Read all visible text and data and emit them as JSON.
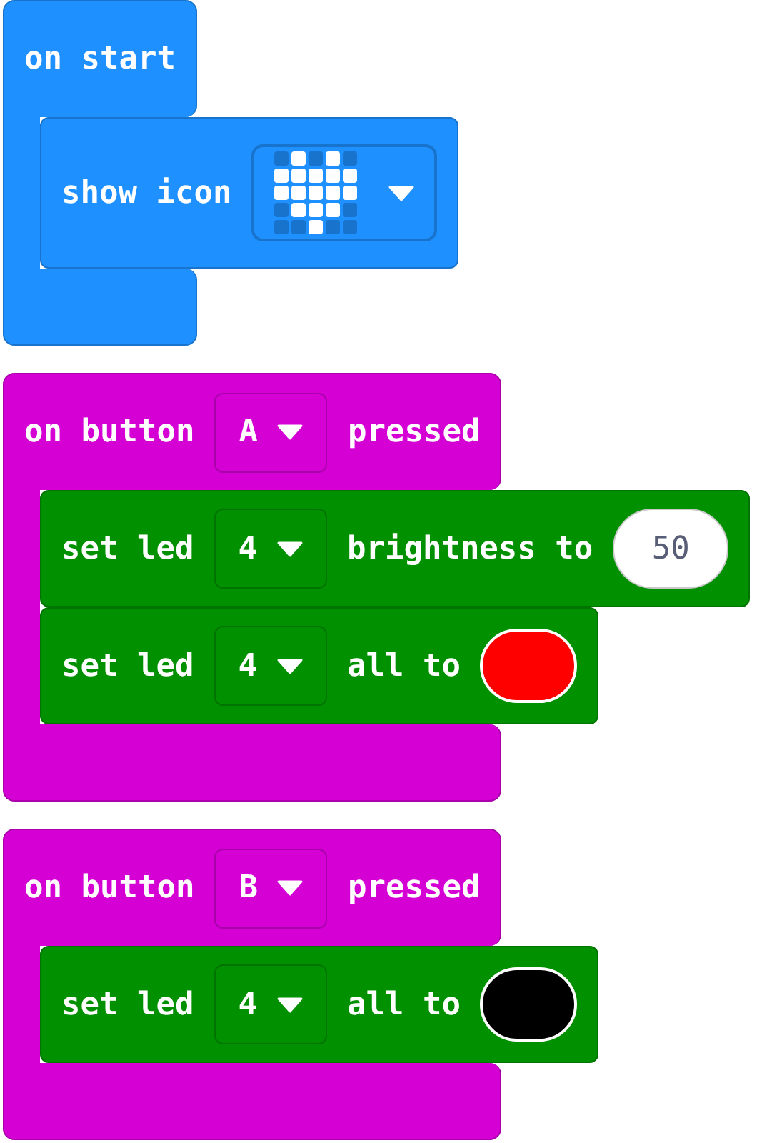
{
  "blocks": [
    {
      "kind": "start",
      "parts": [
        {
          "kind": "text",
          "text": "on start"
        }
      ],
      "body": [
        {
          "kind": "basic",
          "parts": [
            {
              "kind": "text",
              "text": "show icon"
            },
            {
              "kind": "icon",
              "rows": [
                {
                  "cells": [
                    {
                      "on": false
                    },
                    {
                      "on": true
                    },
                    {
                      "on": false
                    },
                    {
                      "on": true
                    },
                    {
                      "on": false
                    }
                  ]
                },
                {
                  "cells": [
                    {
                      "on": true
                    },
                    {
                      "on": true
                    },
                    {
                      "on": true
                    },
                    {
                      "on": true
                    },
                    {
                      "on": true
                    }
                  ]
                },
                {
                  "cells": [
                    {
                      "on": true
                    },
                    {
                      "on": true
                    },
                    {
                      "on": true
                    },
                    {
                      "on": true
                    },
                    {
                      "on": true
                    }
                  ]
                },
                {
                  "cells": [
                    {
                      "on": false
                    },
                    {
                      "on": true
                    },
                    {
                      "on": true
                    },
                    {
                      "on": true
                    },
                    {
                      "on": false
                    }
                  ]
                },
                {
                  "cells": [
                    {
                      "on": false
                    },
                    {
                      "on": false
                    },
                    {
                      "on": true
                    },
                    {
                      "on": false
                    },
                    {
                      "on": false
                    }
                  ]
                }
              ]
            }
          ]
        }
      ]
    },
    {
      "kind": "input",
      "parts": [
        {
          "kind": "text",
          "text": "on button"
        },
        {
          "kind": "dropdown",
          "value": "A"
        },
        {
          "kind": "text",
          "text": "pressed"
        }
      ],
      "body": [
        {
          "kind": "light",
          "parts": [
            {
              "kind": "text",
              "text": "set led"
            },
            {
              "kind": "dropdown",
              "value": "4"
            },
            {
              "kind": "text",
              "text": "brightness to"
            },
            {
              "kind": "number",
              "value": "50"
            }
          ]
        },
        {
          "kind": "light",
          "parts": [
            {
              "kind": "text",
              "text": "set led"
            },
            {
              "kind": "dropdown",
              "value": "4"
            },
            {
              "kind": "text",
              "text": "all to"
            },
            {
              "kind": "color",
              "color": "#ff0000"
            }
          ]
        }
      ]
    },
    {
      "kind": "input",
      "parts": [
        {
          "kind": "text",
          "text": "on button"
        },
        {
          "kind": "dropdown",
          "value": "B"
        },
        {
          "kind": "text",
          "text": "pressed"
        }
      ],
      "body": [
        {
          "kind": "light",
          "parts": [
            {
              "kind": "text",
              "text": "set led"
            },
            {
              "kind": "dropdown",
              "value": "4"
            },
            {
              "kind": "text",
              "text": "all to"
            },
            {
              "kind": "color",
              "color": "#000000"
            }
          ]
        }
      ]
    }
  ]
}
